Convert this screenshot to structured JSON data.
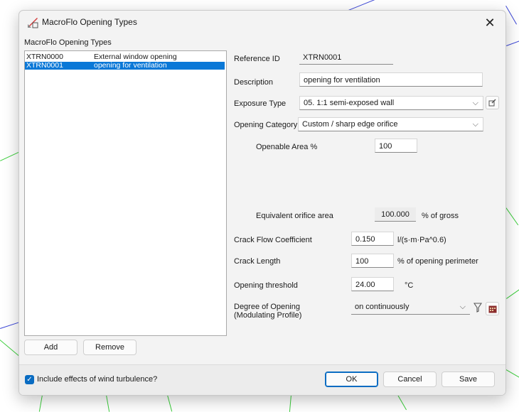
{
  "window": {
    "title": "MacroFlo Opening Types",
    "close_glyph": "✕",
    "icon": "ruler-pencil-icon"
  },
  "list": {
    "group_label": "MacroFlo Opening Types",
    "items": [
      {
        "id": "XTRN0000",
        "description": "External window opening",
        "selected": false
      },
      {
        "id": "XTRN0001",
        "description": "opening for ventilation",
        "selected": true
      }
    ],
    "add_label": "Add",
    "remove_label": "Remove"
  },
  "form": {
    "reference_id_label": "Reference ID",
    "reference_id_value": "XTRN0001",
    "description_label": "Description",
    "description_value": "opening for ventilation",
    "exposure_type_label": "Exposure Type",
    "exposure_type_value": "05. 1:1 semi-exposed wall",
    "opening_category_label": "Opening Category",
    "opening_category_value": "Custom / sharp edge orifice",
    "openable_area_label": "Openable Area %",
    "openable_area_value": "100",
    "equivalent_orifice_label": "Equivalent orifice area",
    "equivalent_orifice_value": "100.000",
    "equivalent_orifice_unit": "% of gross",
    "crack_flow_label": "Crack Flow Coefficient",
    "crack_flow_value": "0.150",
    "crack_flow_unit": "l/(s·m·Pa^0.6)",
    "crack_length_label": "Crack Length",
    "crack_length_value": "100",
    "crack_length_unit": "% of opening perimeter",
    "opening_threshold_label": "Opening threshold",
    "opening_threshold_value": "24.00",
    "opening_threshold_unit": "°C",
    "degree_label_line1": "Degree of Opening",
    "degree_label_line2": "(Modulating Profile)",
    "degree_value": "on continuously"
  },
  "footer": {
    "wind_turbulence_label": "Include effects of wind turbulence?",
    "wind_turbulence_checked": true,
    "ok_label": "OK",
    "cancel_label": "Cancel",
    "save_label": "Save"
  },
  "colors": {
    "accent": "#0a78d7",
    "background_lines": [
      "#2a3fd8",
      "#3bcf3b"
    ]
  }
}
